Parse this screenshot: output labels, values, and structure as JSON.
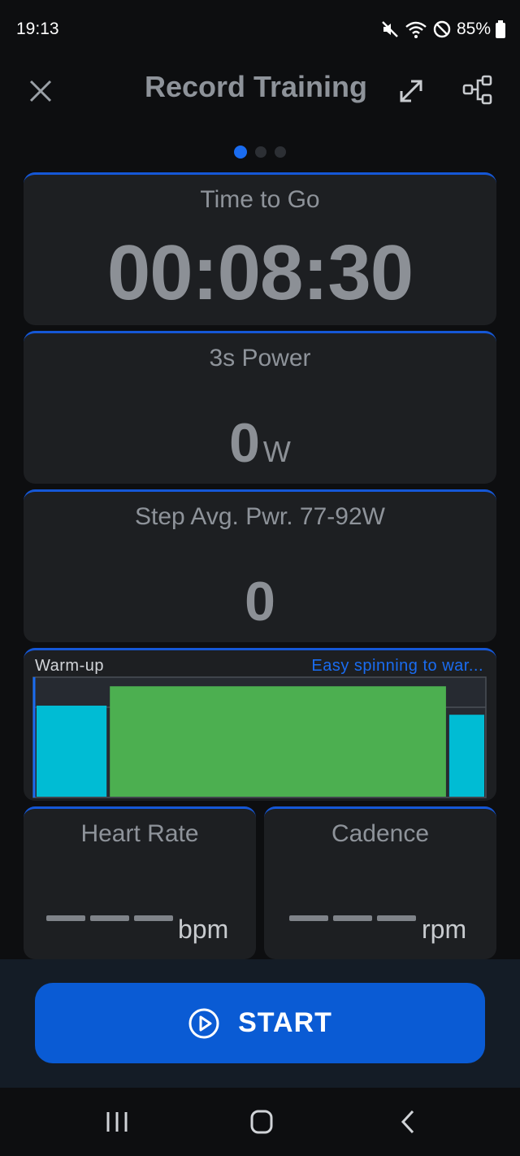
{
  "status_bar": {
    "time": "19:13",
    "battery": "85%",
    "icons": [
      "mute-icon",
      "wifi-icon",
      "dnd-icon",
      "battery-icon"
    ]
  },
  "header": {
    "title": "Record Training",
    "icons": [
      "close-icon",
      "expand-icon",
      "share-icon"
    ]
  },
  "pager": {
    "pages": 3,
    "active": 1
  },
  "time_panel": {
    "label": "Time to Go",
    "value": "00:08:30"
  },
  "power_panel": {
    "label": "3s Power",
    "value": "0",
    "unit": "W"
  },
  "step_panel": {
    "label": "Step Avg. Pwr. 77-92W",
    "value": "0"
  },
  "workout_panel": {
    "step_name": "Warm-up",
    "description": "Easy spinning to war...",
    "colors": {
      "easy": "#00bcd4",
      "main": "#4caf50",
      "accent": "#1a6cf0"
    },
    "segments": [
      {
        "zone": "easy",
        "duration": 1,
        "level": 0.8
      },
      {
        "zone": "main",
        "duration": 4.8,
        "level": 0.97
      },
      {
        "zone": "easy",
        "duration": 0.5,
        "level": 0.72
      }
    ]
  },
  "heart_rate_panel": {
    "label": "Heart Rate",
    "unit": "bpm"
  },
  "cadence_panel": {
    "label": "Cadence",
    "unit": "rpm"
  },
  "footer": {
    "start_label": "START"
  },
  "nav": {
    "icons": [
      "recents-icon",
      "home-icon",
      "back-icon"
    ]
  }
}
